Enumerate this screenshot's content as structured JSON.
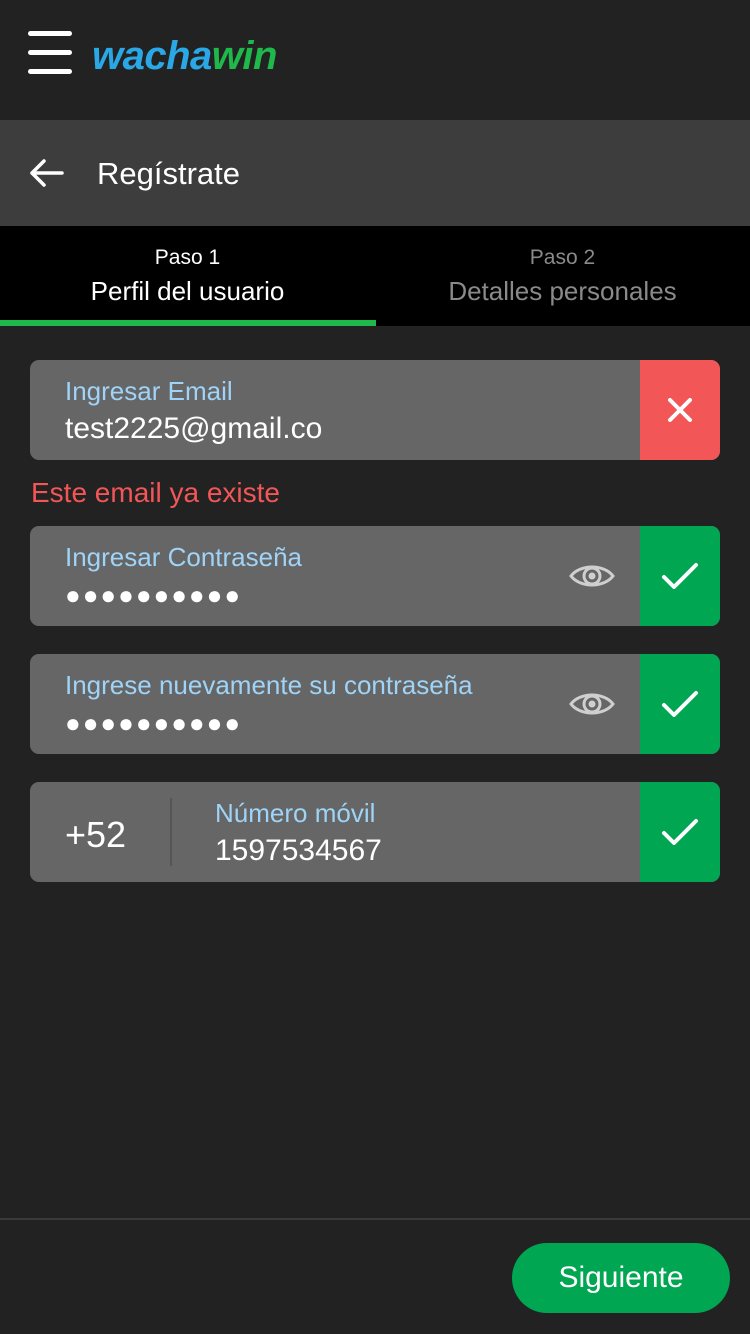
{
  "app": {
    "logo_part1": "wacha",
    "logo_part2": "win",
    "brand_colors": {
      "blue": "#2aa7e5",
      "green": "#1fb84a"
    }
  },
  "header": {
    "title": "Regístrate"
  },
  "steps": [
    {
      "number": "Paso 1",
      "label": "Perfil del usuario",
      "active": true
    },
    {
      "number": "Paso 2",
      "label": "Detalles personales",
      "active": false
    }
  ],
  "form": {
    "email": {
      "label": "Ingresar Email",
      "value": "test2225@gmail.co",
      "status": "error"
    },
    "email_error": "Este email ya existe",
    "password": {
      "label": "Ingresar Contraseña",
      "value": "●●●●●●●●●●",
      "status": "ok"
    },
    "password_confirm": {
      "label": "Ingrese nuevamente su contraseña",
      "value": "●●●●●●●●●●",
      "status": "ok"
    },
    "phone": {
      "prefix": "+52",
      "label": "Número móvil",
      "value": "1597534567",
      "status": "ok"
    }
  },
  "footer": {
    "next_label": "Siguiente"
  },
  "colors": {
    "error": "#f25656",
    "success": "#00a651",
    "label": "#9fd3f7"
  }
}
